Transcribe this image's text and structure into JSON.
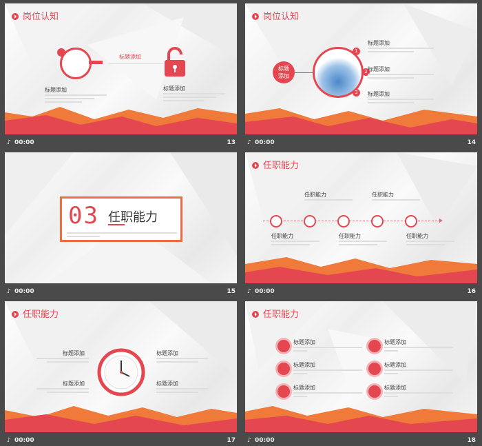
{
  "common": {
    "time": "00:00"
  },
  "slides": [
    {
      "number": "13",
      "title": "岗位认知",
      "connector": "标题添加",
      "left_heading": "标题添加",
      "right_heading": "标题添加"
    },
    {
      "number": "14",
      "title": "岗位认知",
      "center_label": "标题\n添加",
      "badges": [
        "1",
        "2",
        "3"
      ],
      "items": [
        "标题添加",
        "标题添加",
        "标题添加"
      ]
    },
    {
      "number": "15",
      "section_no": "03",
      "section_title": "任职能力"
    },
    {
      "number": "16",
      "title": "任职能力",
      "top_labels": [
        "任职能力",
        "任职能力"
      ],
      "bottom_labels": [
        "任职能力",
        "任职能力",
        "任职能力"
      ]
    },
    {
      "number": "17",
      "title": "任职能力",
      "left_items": [
        "标题添加",
        "标题添加"
      ],
      "right_items": [
        "标题添加",
        "标题添加"
      ]
    },
    {
      "number": "18",
      "title": "任职能力",
      "left_items": [
        "标题添加",
        "标题添加",
        "标题添加"
      ],
      "right_items": [
        "标题添加",
        "标题添加",
        "标题添加"
      ]
    }
  ],
  "colors": {
    "accent": "#e4474f",
    "orange": "#f08a3c",
    "background": "#4a4a4a"
  }
}
